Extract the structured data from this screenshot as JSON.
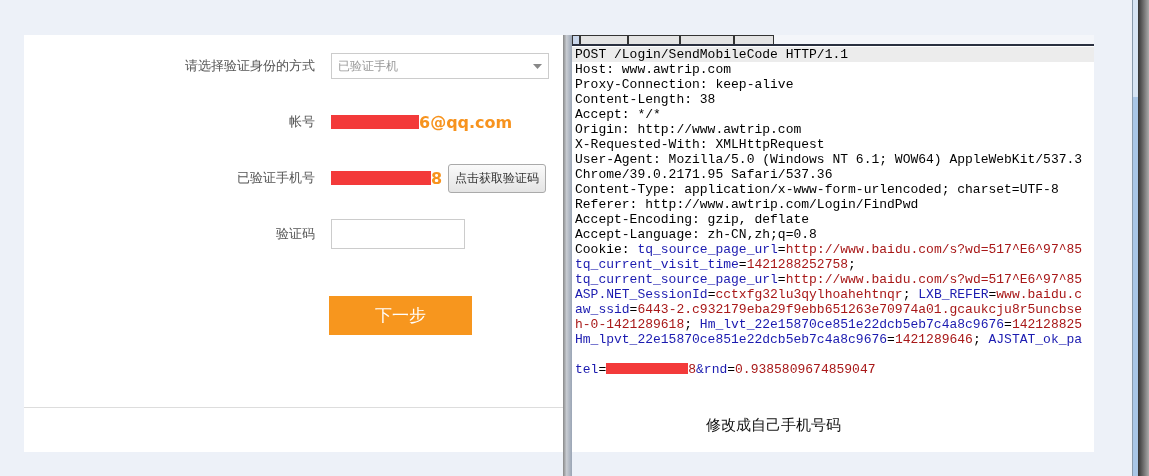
{
  "form": {
    "fields": [
      {
        "kind": "select",
        "label": "请选择验证身份的方式",
        "value": "已验证手机"
      },
      {
        "kind": "redacted_text",
        "label": "帐号",
        "value": "6@qq.com"
      },
      {
        "kind": "redacted_text_button",
        "label": "已验证手机号",
        "value": "8",
        "button": "点击获取验证码"
      },
      {
        "kind": "input",
        "label": "验证码"
      }
    ],
    "next_button": "下一步"
  },
  "request": {
    "lines": [
      {
        "selected": true,
        "segments": [
          {
            "kind": "plain",
            "text": "POST /Login/SendMobileCode HTTP/1.1"
          }
        ]
      },
      {
        "selected": false,
        "segments": [
          {
            "kind": "plain",
            "text": "Host: www.awtrip.com"
          }
        ]
      },
      {
        "selected": false,
        "segments": [
          {
            "kind": "plain",
            "text": "Proxy-Connection: keep-alive"
          }
        ]
      },
      {
        "selected": false,
        "segments": [
          {
            "kind": "plain",
            "text": "Content-Length: 38"
          }
        ]
      },
      {
        "selected": false,
        "segments": [
          {
            "kind": "plain",
            "text": "Accept: */*"
          }
        ]
      },
      {
        "selected": false,
        "segments": [
          {
            "kind": "plain",
            "text": "Origin: http://www.awtrip.com"
          }
        ]
      },
      {
        "selected": false,
        "segments": [
          {
            "kind": "plain",
            "text": "X-Requested-With: XMLHttpRequest"
          }
        ]
      },
      {
        "selected": false,
        "segments": [
          {
            "kind": "plain",
            "text": "User-Agent: Mozilla/5.0 (Windows NT 6.1; WOW64) AppleWebKit/537.3"
          }
        ]
      },
      {
        "selected": false,
        "segments": [
          {
            "kind": "plain",
            "text": "Chrome/39.0.2171.95 Safari/537.36"
          }
        ]
      },
      {
        "selected": false,
        "segments": [
          {
            "kind": "plain",
            "text": "Content-Type: application/x-www-form-urlencoded; charset=UTF-8"
          }
        ]
      },
      {
        "selected": false,
        "segments": [
          {
            "kind": "plain",
            "text": "Referer: http://www.awtrip.com/Login/FindPwd"
          }
        ]
      },
      {
        "selected": false,
        "segments": [
          {
            "kind": "plain",
            "text": "Accept-Encoding: gzip, deflate"
          }
        ]
      },
      {
        "selected": false,
        "segments": [
          {
            "kind": "plain",
            "text": "Accept-Language: zh-CN,zh;q=0.8"
          }
        ]
      },
      {
        "selected": false,
        "segments": [
          {
            "kind": "plain",
            "text": "Cookie: "
          },
          {
            "kind": "key",
            "text": "tq_source_page_url"
          },
          {
            "kind": "plain",
            "text": "="
          },
          {
            "kind": "value",
            "text": "http://www.baidu.com/s?wd=517^E6^97^85"
          }
        ]
      },
      {
        "selected": false,
        "segments": [
          {
            "kind": "key",
            "text": "tq_current_visit_time"
          },
          {
            "kind": "plain",
            "text": "="
          },
          {
            "kind": "value",
            "text": "1421288252758"
          },
          {
            "kind": "plain",
            "text": ";"
          }
        ]
      },
      {
        "selected": false,
        "segments": [
          {
            "kind": "key",
            "text": "tq_current_source_page_url"
          },
          {
            "kind": "plain",
            "text": "="
          },
          {
            "kind": "value",
            "text": "http://www.baidu.com/s?wd=517^E6^97^85"
          }
        ]
      },
      {
        "selected": false,
        "segments": [
          {
            "kind": "key",
            "text": "ASP.NET_SessionId"
          },
          {
            "kind": "plain",
            "text": "="
          },
          {
            "kind": "value",
            "text": "cctxfg32lu3qylhoahehtnqr"
          },
          {
            "kind": "plain",
            "text": "; "
          },
          {
            "kind": "key",
            "text": "LXB_REFER"
          },
          {
            "kind": "plain",
            "text": "="
          },
          {
            "kind": "value",
            "text": "www.baidu.c"
          }
        ]
      },
      {
        "selected": false,
        "segments": [
          {
            "kind": "key",
            "text": "aw_ssid"
          },
          {
            "kind": "plain",
            "text": "="
          },
          {
            "kind": "value",
            "text": "6443-2.c932179eba29f9ebb651263e70974a01.gcaukcju8r5uncbse"
          }
        ]
      },
      {
        "selected": false,
        "segments": [
          {
            "kind": "value",
            "text": "h-0-1421289618"
          },
          {
            "kind": "plain",
            "text": "; "
          },
          {
            "kind": "key",
            "text": "Hm_lvt_22e15870ce851e22dcb5eb7c4a8c9676"
          },
          {
            "kind": "plain",
            "text": "="
          },
          {
            "kind": "value",
            "text": "142128825"
          }
        ]
      },
      {
        "selected": false,
        "segments": [
          {
            "kind": "key",
            "text": "Hm_lpvt_22e15870ce851e22dcb5eb7c4a8c9676"
          },
          {
            "kind": "plain",
            "text": "="
          },
          {
            "kind": "value",
            "text": "1421289646"
          },
          {
            "kind": "plain",
            "text": "; "
          },
          {
            "kind": "key",
            "text": "AJSTAT_ok_pa"
          }
        ]
      },
      {
        "selected": false,
        "segments": [
          {
            "kind": "key",
            "text": "tel"
          },
          {
            "kind": "plain",
            "text": "="
          },
          {
            "kind": "redacted"
          },
          {
            "kind": "value",
            "text": "8"
          },
          {
            "kind": "key",
            "text": "&rnd"
          },
          {
            "kind": "plain",
            "text": "="
          },
          {
            "kind": "value",
            "text": "0.9385809674859047"
          }
        ]
      }
    ]
  },
  "annotation": "修改成自己手机号码"
}
